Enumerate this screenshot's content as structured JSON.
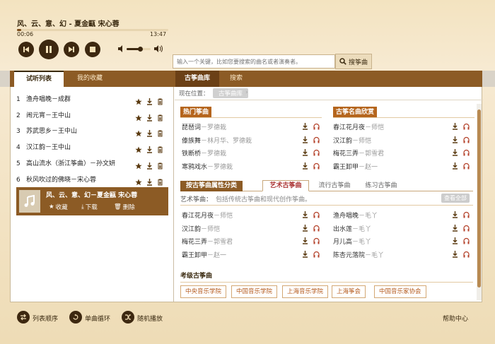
{
  "player": {
    "song_title": "风、云、意、幻 - 夏金甌 宋心蓉",
    "time_current": "00:06",
    "time_total": "13:47",
    "progress_fraction": 0.03,
    "volume_fraction": 0.55,
    "search_placeholder": "输入一个关键，比如您要搜索的曲名或者演奏者。",
    "search_button": "搜筝曲",
    "buttons": {
      "prev": "previous-icon",
      "play": "pause-icon",
      "next": "next-icon",
      "stop": "stop-icon"
    }
  },
  "left_tabs": [
    {
      "label": "试听列表",
      "active": true
    },
    {
      "label": "我的收藏",
      "active": false
    }
  ],
  "right_tabs": [
    {
      "label": "古筝曲库",
      "active": true
    },
    {
      "label": "搜索",
      "active": false
    }
  ],
  "playlist": [
    {
      "num": "1",
      "name": "渔舟唱晚－成群"
    },
    {
      "num": "2",
      "name": "闹元宵－王中山"
    },
    {
      "num": "3",
      "name": "苏武思乡－王中山"
    },
    {
      "num": "4",
      "name": "汉江韵－王中山"
    },
    {
      "num": "5",
      "name": "高山流水（浙江筝曲）－孙文妍"
    },
    {
      "num": "6",
      "name": "秋风吹过的佛晓－宋心蓉"
    }
  ],
  "now_playing": {
    "title": "风、云、意、幻－夏金甌 宋心蓉",
    "collect": "收藏",
    "download": "下载",
    "delete": "删除"
  },
  "location": {
    "label": "现在位置：",
    "crumb": "古筝曲库"
  },
  "hot_section": {
    "title": "热门筝曲",
    "items": [
      {
        "name": "琵琶词",
        "artist": "－罗德栽"
      },
      {
        "name": "傣族舞",
        "artist": "－林月华、罗德栽"
      },
      {
        "name": "铁断桥",
        "artist": "－罗德栽"
      },
      {
        "name": "寒鸦戏水",
        "artist": "－罗德栽"
      }
    ]
  },
  "classic_section": {
    "title": "古筝名曲欣赏",
    "items": [
      {
        "name": "春江花月夜",
        "artist": "－师恺"
      },
      {
        "name": "汉江韵",
        "artist": "－师恺"
      },
      {
        "name": "梅花三弄",
        "artist": "－郭雪君"
      },
      {
        "name": "霸王卸甲",
        "artist": "－赵一"
      }
    ]
  },
  "category_tabs": [
    {
      "label": "按古筝曲属性分类",
      "style": "first"
    },
    {
      "label": "艺术古筝曲",
      "style": "on"
    },
    {
      "label": "流行古筝曲",
      "style": ""
    },
    {
      "label": "练习古筝曲",
      "style": ""
    }
  ],
  "art_desc": {
    "label": "艺术筝曲：",
    "text": "包括传统古筝曲和现代创作筝曲。",
    "view_all": "查看全部"
  },
  "art_items_left": [
    {
      "name": "春江花月夜",
      "artist": "－师恺"
    },
    {
      "name": "汉江韵",
      "artist": "－师恺"
    },
    {
      "name": "梅花三弄",
      "artist": "－郭雪君"
    },
    {
      "name": "霸王卸甲",
      "artist": "－赵一"
    }
  ],
  "art_items_right": [
    {
      "name": "渔舟唱晚",
      "artist": "－毛丫"
    },
    {
      "name": "出水莲",
      "artist": "－毛丫"
    },
    {
      "name": "月儿高",
      "artist": "－毛丫"
    },
    {
      "name": "陈杏元落院",
      "artist": "－毛丫"
    }
  ],
  "exam_section": {
    "title": "考级古筝曲",
    "buttons": [
      "中央音乐学院",
      "中国音乐学院",
      "上海音乐学院",
      "上海筝会",
      "中国音乐家协会"
    ]
  },
  "footer": {
    "order": "列表顺序",
    "single_loop": "单曲循环",
    "random": "随机播放",
    "help": "帮助中心"
  }
}
